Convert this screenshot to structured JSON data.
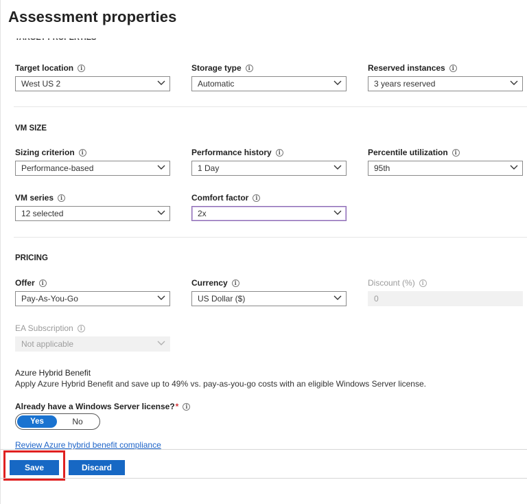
{
  "page": {
    "title": "Assessment properties"
  },
  "target_properties": {
    "heading": "TARGET PROPERTIES",
    "target_location": {
      "label": "Target location",
      "value": "West US 2"
    },
    "storage_type": {
      "label": "Storage type",
      "value": "Automatic"
    },
    "reserved_instances": {
      "label": "Reserved instances",
      "value": "3 years reserved"
    }
  },
  "vm_size": {
    "heading": "VM SIZE",
    "sizing_criterion": {
      "label": "Sizing criterion",
      "value": "Performance-based"
    },
    "performance_history": {
      "label": "Performance history",
      "value": "1 Day"
    },
    "percentile_utilization": {
      "label": "Percentile utilization",
      "value": "95th"
    },
    "vm_series": {
      "label": "VM series",
      "value": "12 selected"
    },
    "comfort_factor": {
      "label": "Comfort factor",
      "value": "2x"
    }
  },
  "pricing": {
    "heading": "PRICING",
    "offer": {
      "label": "Offer",
      "value": "Pay-As-You-Go"
    },
    "currency": {
      "label": "Currency",
      "value": "US Dollar ($)"
    },
    "discount": {
      "label": "Discount (%)",
      "value": "0"
    },
    "ea_subscription": {
      "label": "EA Subscription",
      "value": "Not applicable"
    }
  },
  "hybrid": {
    "title": "Azure Hybrid Benefit",
    "description": "Apply Azure Hybrid Benefit and save up to 49% vs. pay-as-you-go costs with an eligible Windows Server license.",
    "question": "Already have a Windows Server license?",
    "required_mark": "*",
    "yes_label": "Yes",
    "no_label": "No",
    "selected": "Yes",
    "compliance_link": "Review Azure hybrid benefit compliance"
  },
  "footer": {
    "save_label": "Save",
    "discard_label": "Discard"
  },
  "icons": {
    "info": "info-icon",
    "chevron": "chevron-down-icon"
  },
  "colors": {
    "primary": "#1768c4",
    "highlight": "#e02020",
    "link": "#1e64c8",
    "focus": "#8c6bb1"
  }
}
